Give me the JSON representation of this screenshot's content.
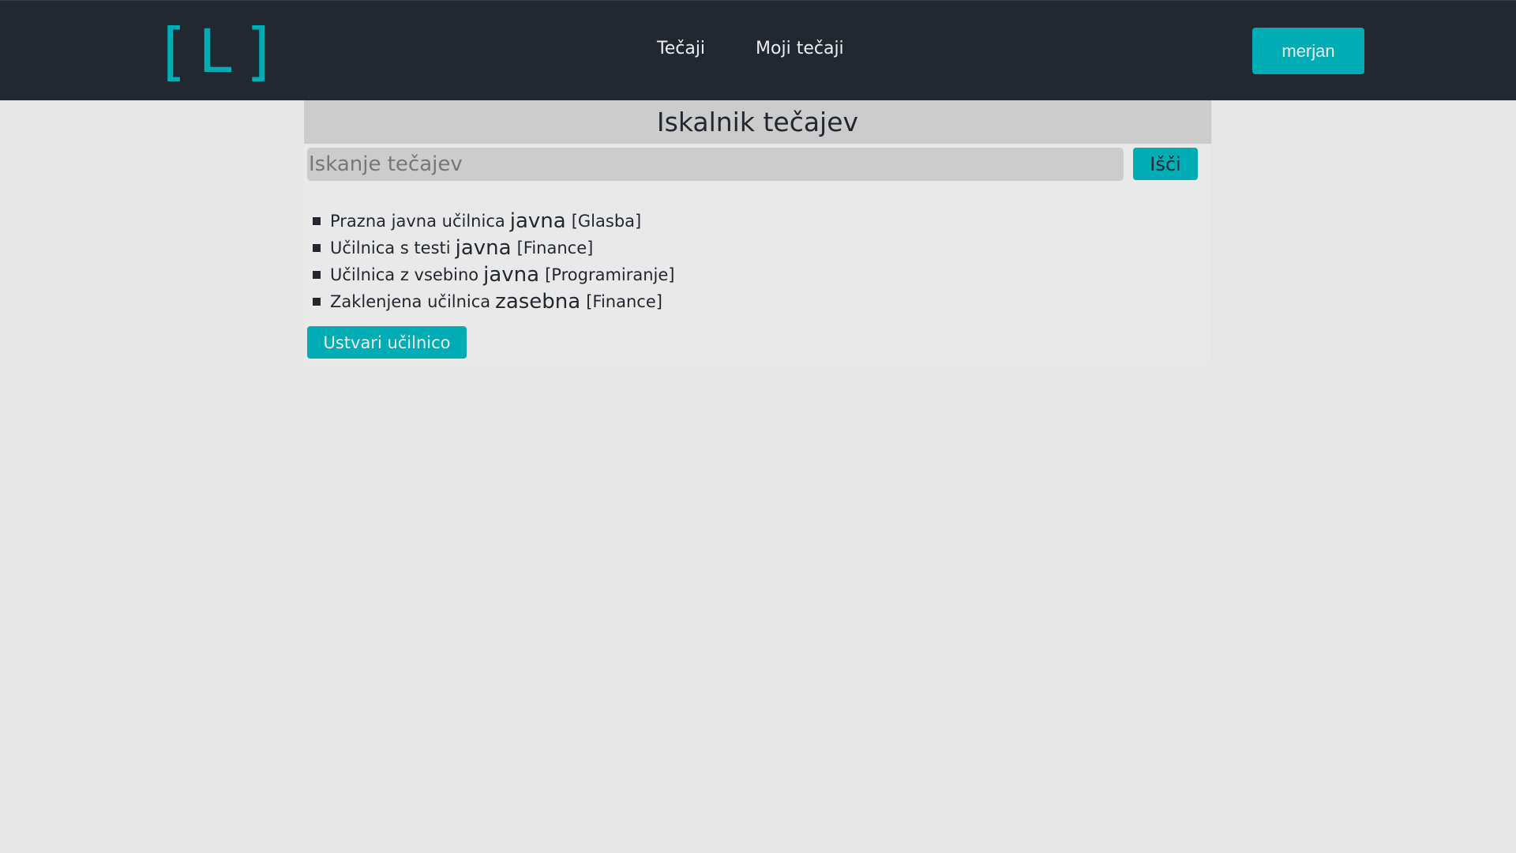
{
  "header": {
    "logo": {
      "left_bracket": "[",
      "letter": "L",
      "right_bracket": "]"
    },
    "nav": [
      {
        "label": "Tečaji"
      },
      {
        "label": "Moji tečaji"
      }
    ],
    "user_button_label": "merjan"
  },
  "main": {
    "title": "Iskalnik tečajev",
    "search": {
      "placeholder": "Iskanje tečajev",
      "value": "",
      "button_label": "Išči"
    },
    "courses": [
      {
        "name": "Prazna javna učilnica",
        "visibility": "javna",
        "category": "[Glasba]"
      },
      {
        "name": "Učilnica s testi",
        "visibility": "javna",
        "category": "[Finance]"
      },
      {
        "name": "Učilnica z vsebino",
        "visibility": "javna",
        "category": "[Programiranje]"
      },
      {
        "name": "Zaklenjena učilnica",
        "visibility": "zasebna",
        "category": "[Finance]"
      }
    ],
    "create_button_label": "Ustvari učilnico"
  },
  "colors": {
    "accent": "#00adb5",
    "navbar": "#222831",
    "background": "#e8e8e8",
    "panel_header": "#cccccc",
    "text": "#222831"
  }
}
